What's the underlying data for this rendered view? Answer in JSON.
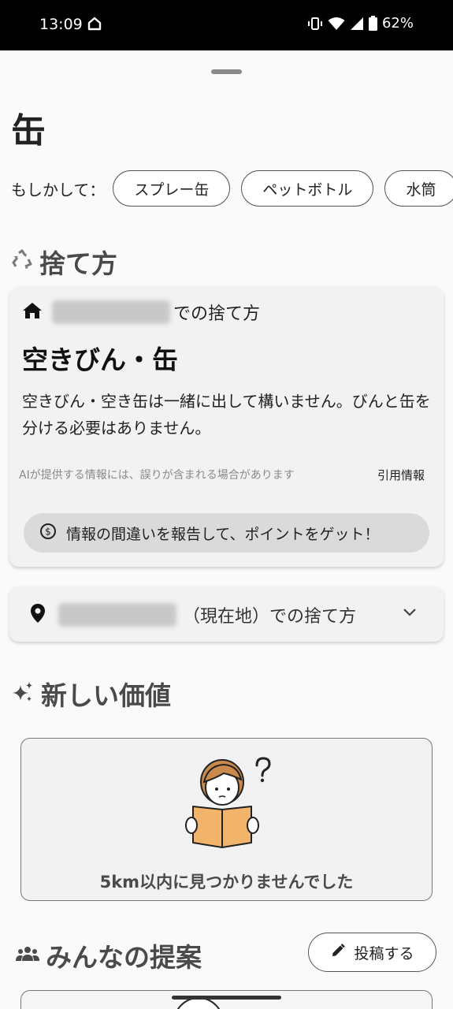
{
  "status_bar": {
    "time": "13:09",
    "battery": "62%",
    "icons": [
      "home-icon",
      "vibrate-icon",
      "wifi-icon",
      "signal-icon",
      "battery-icon"
    ]
  },
  "page": {
    "title": "缶"
  },
  "suggestions": {
    "label": "もしかして：",
    "chips": [
      "スプレー缶",
      "ペットボトル",
      "水筒"
    ]
  },
  "disposal_section": {
    "heading": "捨て方",
    "card": {
      "location_suffix": "での捨て方",
      "category": "空きびん・缶",
      "description": "空きびん・空き缶は一緒に出して構いません。びんと缶を分ける必要はありません。",
      "disclaimer": "AIが提供する情報には、誤りが含まれる場合があります",
      "citation_label": "引用情報",
      "report_button": "情報の間違いを報告して、ポイントをゲット！"
    },
    "current_location_card": {
      "suffix": "（現在地）での捨て方"
    }
  },
  "new_value_section": {
    "heading": "新しい価値",
    "empty_message": "5km以内に見つかりませんでした"
  },
  "proposals_section": {
    "heading": "みんなの提案",
    "post_button": "投稿する"
  },
  "colors": {
    "status_bar_bg": "#000000",
    "sheet_bg": "#fafafa",
    "card_bg": "#f2f2f2",
    "report_bg": "#dadada",
    "heading_gray": "#4a4a4a",
    "illustration_orange": "#f2b46a",
    "hair_brown": "#c98a4b"
  }
}
